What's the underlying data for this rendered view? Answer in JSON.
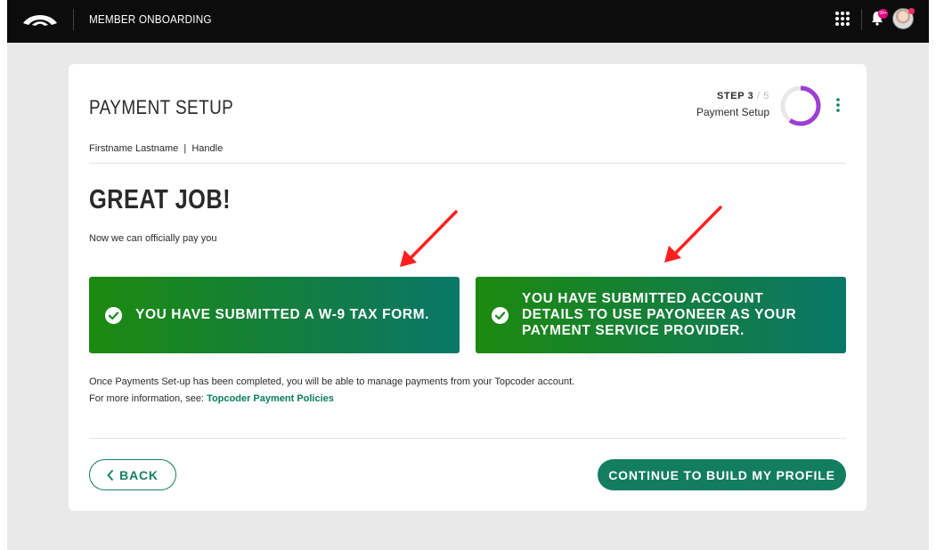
{
  "header": {
    "app_title": "MEMBER ONBOARDING",
    "notification_count": "99+",
    "icons": [
      "topcoder-logo-icon",
      "apps-grid-icon",
      "bell-icon",
      "avatar"
    ]
  },
  "card": {
    "title": "PAYMENT SETUP",
    "step": {
      "label": "STEP 3",
      "separator": " / ",
      "total": "5",
      "name": "Payment Setup",
      "progress": 0.6
    },
    "user_line": "Firstname Lastname  |  Handle",
    "headline": "GREAT JOB!",
    "subtext": "Now we can officially pay you",
    "tiles": [
      {
        "text": "You have submitted a W-9 tax form."
      },
      {
        "text": "You have submitted account details to use Payoneer as your payment service provider."
      }
    ],
    "info_line1": "Once Payments Set-up has been completed, you will be able to manage payments from your Topcoder account.",
    "info_line2_prefix": "For more information, see:",
    "info_link": "Topcoder Payment Policies",
    "back_label": "BACK",
    "continue_label": "CONTINUE TO BUILD MY PROFILE"
  },
  "colors": {
    "brand_green": "#137d60",
    "tile_gradient_start": "#1c8a0f",
    "tile_gradient_end": "#0a7768",
    "progress_ring": "#9c3fd3",
    "annotation_arrow": "#ff1f1f"
  }
}
